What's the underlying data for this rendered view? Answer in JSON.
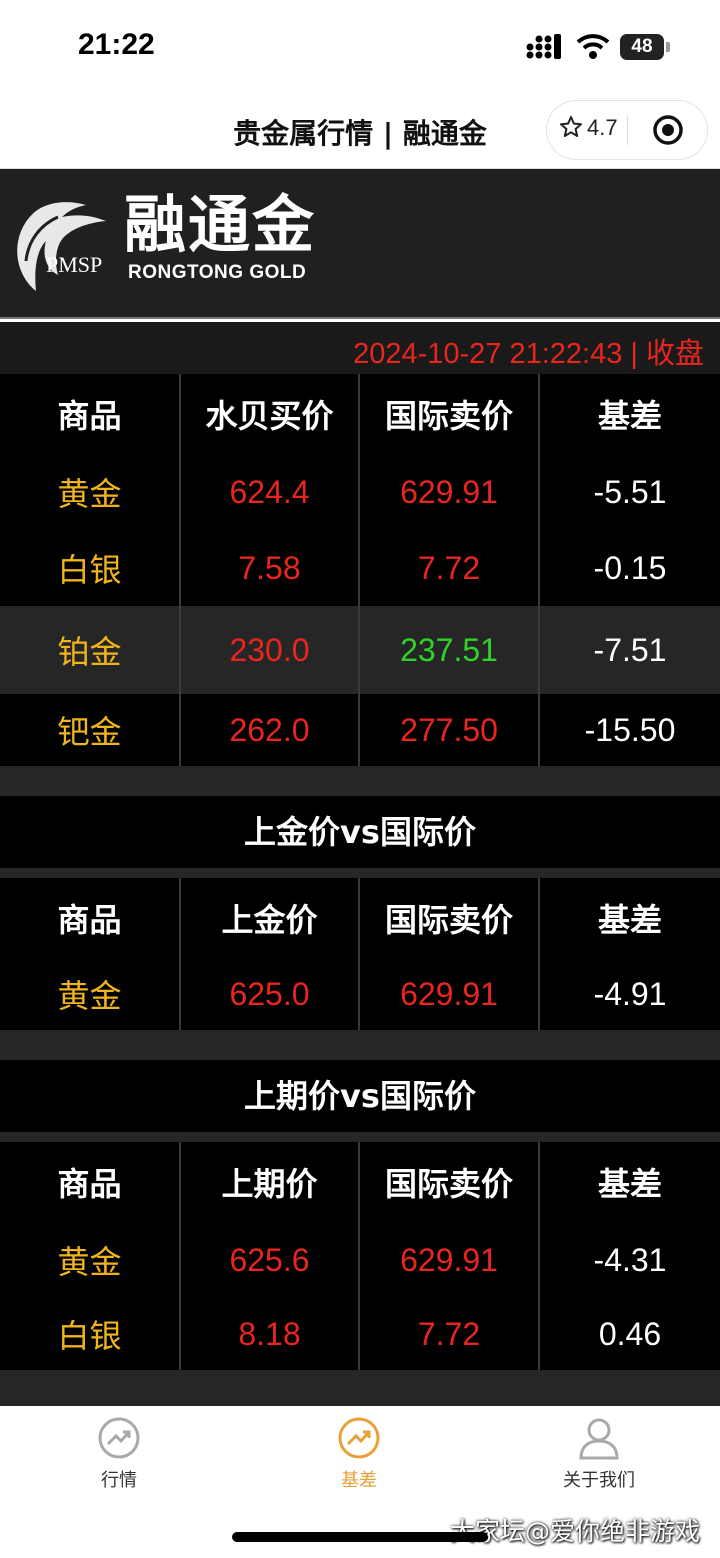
{
  "status": {
    "time": "21:22",
    "battery": "48"
  },
  "nav": {
    "title": "贵金属行情 | 融通金",
    "rating": "4.7"
  },
  "banner": {
    "logo_cn": "融通金",
    "logo_en": "RONGTONG  GOLD",
    "logo_pmsp": "PMSP"
  },
  "datetime": "2024-10-27  21:22:43 | 收盘",
  "table1": {
    "headers": [
      "商品",
      "水贝买价",
      "国际卖价",
      "基差"
    ],
    "rows": [
      [
        "黄金",
        "624.4",
        "629.91",
        "-5.51"
      ],
      [
        "白银",
        "7.58",
        "7.72",
        "-0.15"
      ],
      [
        "铂金",
        "230.0",
        "237.51",
        "-7.51"
      ],
      [
        "钯金",
        "262.0",
        "277.50",
        "-15.50"
      ]
    ]
  },
  "table2": {
    "title": "上金价vs国际价",
    "headers": [
      "商品",
      "上金价",
      "国际卖价",
      "基差"
    ],
    "rows": [
      [
        "黄金",
        "625.0",
        "629.91",
        "-4.91"
      ]
    ]
  },
  "table3": {
    "title": "上期价vs国际价",
    "headers": [
      "商品",
      "上期价",
      "国际卖价",
      "基差"
    ],
    "rows": [
      [
        "黄金",
        "625.6",
        "629.91",
        "-4.31"
      ],
      [
        "白银",
        "8.18",
        "7.72",
        "0.46"
      ]
    ]
  },
  "tabs": [
    {
      "label": "行情",
      "icon": "trend-chart-icon"
    },
    {
      "label": "基差",
      "icon": "trend-chart-icon"
    },
    {
      "label": "关于我们",
      "icon": "user-icon"
    }
  ],
  "watermark": "大家坛@爱你绝非游戏",
  "colors": {
    "price_up": "#e8261e",
    "price_down": "#2fd32a",
    "name": "#f0b51b",
    "active_tab": "#e8a03a"
  }
}
